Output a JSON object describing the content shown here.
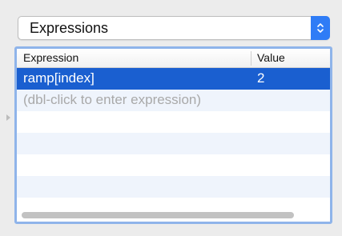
{
  "popup": {
    "selected": "Expressions",
    "arrow_icon": "up-down-chevron-icon",
    "accent_color": "#2f7cf6"
  },
  "table": {
    "columns": [
      "Expression",
      "Value"
    ],
    "rows": [
      {
        "expression": "ramp[index]",
        "value": "2",
        "selected": true
      },
      {
        "expression": "(dbl-click to enter expression)",
        "value": "",
        "placeholder": true
      }
    ],
    "selection_color": "#1a5fd0",
    "frame_color": "#8fb4ea"
  }
}
